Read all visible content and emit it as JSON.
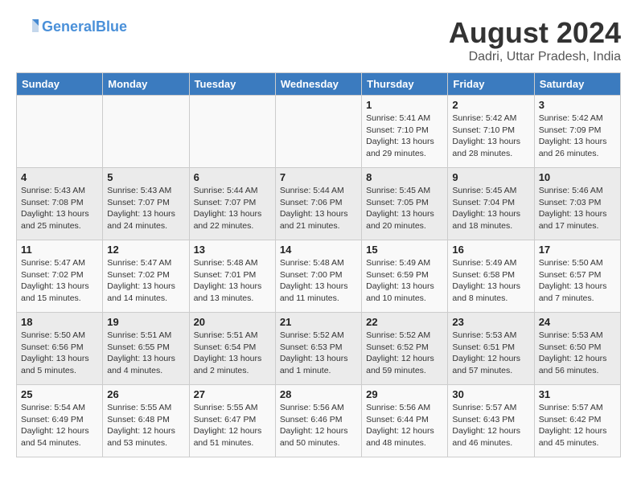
{
  "header": {
    "logo_line1": "General",
    "logo_line2": "Blue",
    "month_year": "August 2024",
    "location": "Dadri, Uttar Pradesh, India"
  },
  "days_of_week": [
    "Sunday",
    "Monday",
    "Tuesday",
    "Wednesday",
    "Thursday",
    "Friday",
    "Saturday"
  ],
  "weeks": [
    [
      {
        "day": "",
        "info": ""
      },
      {
        "day": "",
        "info": ""
      },
      {
        "day": "",
        "info": ""
      },
      {
        "day": "",
        "info": ""
      },
      {
        "day": "1",
        "info": "Sunrise: 5:41 AM\nSunset: 7:10 PM\nDaylight: 13 hours\nand 29 minutes."
      },
      {
        "day": "2",
        "info": "Sunrise: 5:42 AM\nSunset: 7:10 PM\nDaylight: 13 hours\nand 28 minutes."
      },
      {
        "day": "3",
        "info": "Sunrise: 5:42 AM\nSunset: 7:09 PM\nDaylight: 13 hours\nand 26 minutes."
      }
    ],
    [
      {
        "day": "4",
        "info": "Sunrise: 5:43 AM\nSunset: 7:08 PM\nDaylight: 13 hours\nand 25 minutes."
      },
      {
        "day": "5",
        "info": "Sunrise: 5:43 AM\nSunset: 7:07 PM\nDaylight: 13 hours\nand 24 minutes."
      },
      {
        "day": "6",
        "info": "Sunrise: 5:44 AM\nSunset: 7:07 PM\nDaylight: 13 hours\nand 22 minutes."
      },
      {
        "day": "7",
        "info": "Sunrise: 5:44 AM\nSunset: 7:06 PM\nDaylight: 13 hours\nand 21 minutes."
      },
      {
        "day": "8",
        "info": "Sunrise: 5:45 AM\nSunset: 7:05 PM\nDaylight: 13 hours\nand 20 minutes."
      },
      {
        "day": "9",
        "info": "Sunrise: 5:45 AM\nSunset: 7:04 PM\nDaylight: 13 hours\nand 18 minutes."
      },
      {
        "day": "10",
        "info": "Sunrise: 5:46 AM\nSunset: 7:03 PM\nDaylight: 13 hours\nand 17 minutes."
      }
    ],
    [
      {
        "day": "11",
        "info": "Sunrise: 5:47 AM\nSunset: 7:02 PM\nDaylight: 13 hours\nand 15 minutes."
      },
      {
        "day": "12",
        "info": "Sunrise: 5:47 AM\nSunset: 7:02 PM\nDaylight: 13 hours\nand 14 minutes."
      },
      {
        "day": "13",
        "info": "Sunrise: 5:48 AM\nSunset: 7:01 PM\nDaylight: 13 hours\nand 13 minutes."
      },
      {
        "day": "14",
        "info": "Sunrise: 5:48 AM\nSunset: 7:00 PM\nDaylight: 13 hours\nand 11 minutes."
      },
      {
        "day": "15",
        "info": "Sunrise: 5:49 AM\nSunset: 6:59 PM\nDaylight: 13 hours\nand 10 minutes."
      },
      {
        "day": "16",
        "info": "Sunrise: 5:49 AM\nSunset: 6:58 PM\nDaylight: 13 hours\nand 8 minutes."
      },
      {
        "day": "17",
        "info": "Sunrise: 5:50 AM\nSunset: 6:57 PM\nDaylight: 13 hours\nand 7 minutes."
      }
    ],
    [
      {
        "day": "18",
        "info": "Sunrise: 5:50 AM\nSunset: 6:56 PM\nDaylight: 13 hours\nand 5 minutes."
      },
      {
        "day": "19",
        "info": "Sunrise: 5:51 AM\nSunset: 6:55 PM\nDaylight: 13 hours\nand 4 minutes."
      },
      {
        "day": "20",
        "info": "Sunrise: 5:51 AM\nSunset: 6:54 PM\nDaylight: 13 hours\nand 2 minutes."
      },
      {
        "day": "21",
        "info": "Sunrise: 5:52 AM\nSunset: 6:53 PM\nDaylight: 13 hours\nand 1 minute."
      },
      {
        "day": "22",
        "info": "Sunrise: 5:52 AM\nSunset: 6:52 PM\nDaylight: 12 hours\nand 59 minutes."
      },
      {
        "day": "23",
        "info": "Sunrise: 5:53 AM\nSunset: 6:51 PM\nDaylight: 12 hours\nand 57 minutes."
      },
      {
        "day": "24",
        "info": "Sunrise: 5:53 AM\nSunset: 6:50 PM\nDaylight: 12 hours\nand 56 minutes."
      }
    ],
    [
      {
        "day": "25",
        "info": "Sunrise: 5:54 AM\nSunset: 6:49 PM\nDaylight: 12 hours\nand 54 minutes."
      },
      {
        "day": "26",
        "info": "Sunrise: 5:55 AM\nSunset: 6:48 PM\nDaylight: 12 hours\nand 53 minutes."
      },
      {
        "day": "27",
        "info": "Sunrise: 5:55 AM\nSunset: 6:47 PM\nDaylight: 12 hours\nand 51 minutes."
      },
      {
        "day": "28",
        "info": "Sunrise: 5:56 AM\nSunset: 6:46 PM\nDaylight: 12 hours\nand 50 minutes."
      },
      {
        "day": "29",
        "info": "Sunrise: 5:56 AM\nSunset: 6:44 PM\nDaylight: 12 hours\nand 48 minutes."
      },
      {
        "day": "30",
        "info": "Sunrise: 5:57 AM\nSunset: 6:43 PM\nDaylight: 12 hours\nand 46 minutes."
      },
      {
        "day": "31",
        "info": "Sunrise: 5:57 AM\nSunset: 6:42 PM\nDaylight: 12 hours\nand 45 minutes."
      }
    ]
  ]
}
